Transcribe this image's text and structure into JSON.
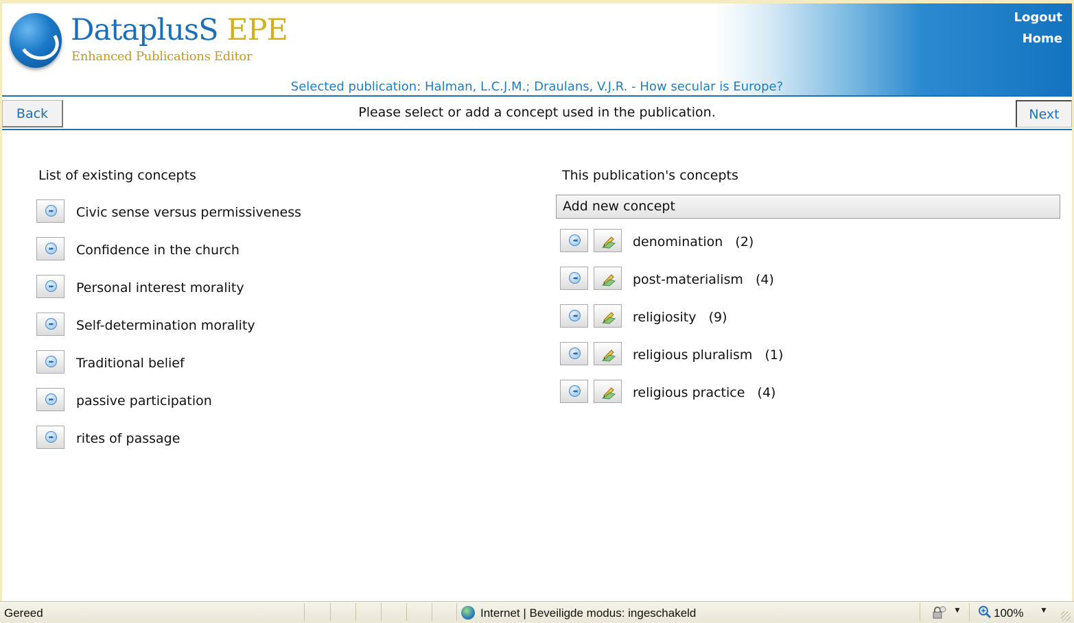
{
  "header": {
    "brand_part1": "DataplusS",
    "brand_part2": "EPE",
    "tagline": "Enhanced Publications Editor",
    "logout": "Logout",
    "home": "Home",
    "selected_publication": "Selected publication: Halman, L.C.J.M.; Draulans, V.J.R. - How secular is Europe?"
  },
  "nav": {
    "back": "Back",
    "next": "Next",
    "instruction": "Please select or add a concept used in the publication."
  },
  "existing": {
    "heading": "List of existing concepts",
    "items": [
      {
        "label": "Civic sense versus permissiveness"
      },
      {
        "label": "Confidence in the church"
      },
      {
        "label": "Personal interest morality"
      },
      {
        "label": "Self-determination morality"
      },
      {
        "label": "Traditional belief"
      },
      {
        "label": "passive participation"
      },
      {
        "label": "rites of passage"
      }
    ]
  },
  "publication": {
    "heading": "This publication's concepts",
    "add_new": "Add new concept",
    "items": [
      {
        "label": "denomination   (2)"
      },
      {
        "label": "post-materialism   (4)"
      },
      {
        "label": "religiosity   (9)"
      },
      {
        "label": "religious pluralism   (1)"
      },
      {
        "label": "religious practice   (4)"
      }
    ]
  },
  "statusbar": {
    "status": "Gereed",
    "zone": "Internet | Beveiligde modus: ingeschakeld",
    "zoom": "100%"
  },
  "icons": {
    "add": "double-chevron-right-icon",
    "remove": "double-chevron-left-icon",
    "edit": "pencil-edit-icon",
    "zone": "globe-icon",
    "security": "lock-icon",
    "zoom": "magnifier-icon"
  },
  "colors": {
    "accent_blue": "#1d6fb6",
    "link_blue": "#1c7fc4",
    "brand_gold": "#d4b01a"
  }
}
